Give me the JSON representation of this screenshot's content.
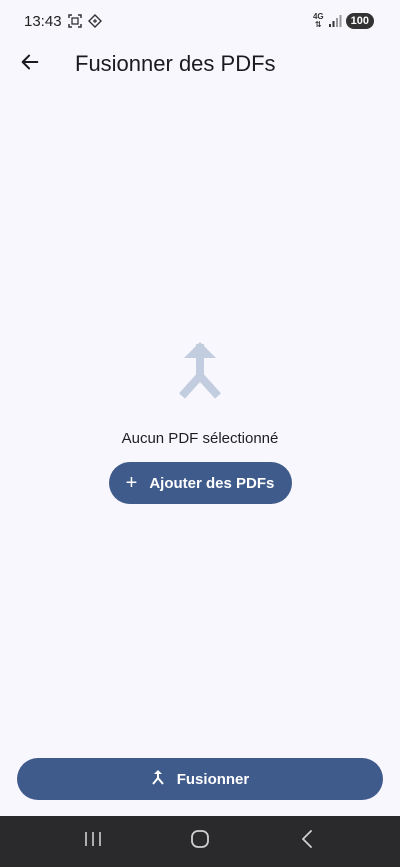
{
  "status_bar": {
    "time": "13:43",
    "network": "4G",
    "battery": "100",
    "icons": [
      "screenshot-icon",
      "nfc-icon",
      "signal-icon"
    ]
  },
  "app_bar": {
    "title": "Fusionner des PDFs",
    "back_icon": "arrow-back-icon"
  },
  "empty_state": {
    "icon": "merge-icon",
    "message": "Aucun PDF sélectionné",
    "add_button_label": "Ajouter des PDFs",
    "add_button_icon": "plus-icon"
  },
  "merge_button": {
    "label": "Fusionner",
    "icon": "merge-icon"
  },
  "nav_bar": {
    "icons": [
      "recent-apps-icon",
      "home-icon",
      "back-icon"
    ]
  },
  "colors": {
    "background": "#f8f7fd",
    "primary": "#3f5b8c",
    "illustration": "#c2cde0",
    "nav_bar": "#2a2a2c"
  }
}
